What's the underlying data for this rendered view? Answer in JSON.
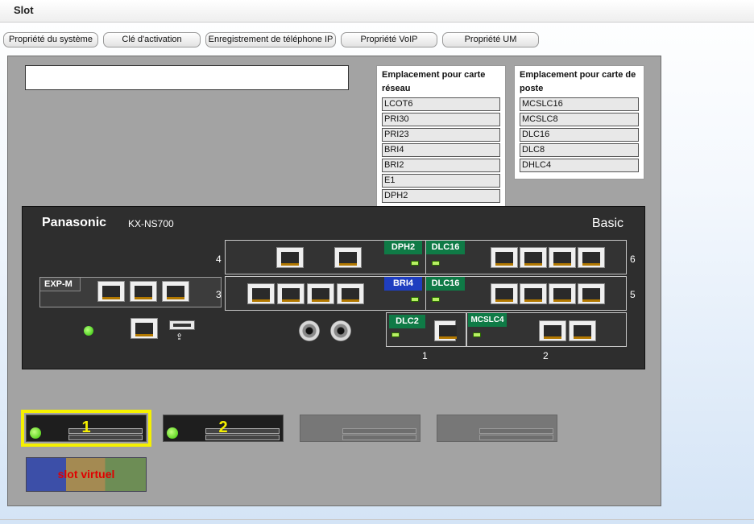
{
  "window": {
    "title": "Slot"
  },
  "tabs": [
    "Propriété du système",
    "Clé d'activation",
    "Enregistrement de téléphone IP",
    "Propriété VoIP",
    "Propriété UM"
  ],
  "network_slots": {
    "header": "Emplacement pour carte réseau",
    "items": [
      "LCOT6",
      "PRI30",
      "PRI23",
      "BRI4",
      "BRI2",
      "E1",
      "DPH2"
    ]
  },
  "extension_slots": {
    "header": "Emplacement pour carte de poste",
    "items": [
      "MCSLC16",
      "MCSLC8",
      "DLC16",
      "DLC8",
      "DHLC4"
    ]
  },
  "device": {
    "brand": "Panasonic",
    "model": "KX-NS700",
    "edition": "Basic",
    "exp_label": "EXP-M",
    "slot_numbers": {
      "s1": "1",
      "s2": "2",
      "s3": "3",
      "s4": "4",
      "s5": "5",
      "s6": "6"
    },
    "cards": {
      "slot4_left": "DPH2",
      "slot6_right": "DLC16",
      "slot3_left": "BRI4",
      "slot5_right": "DLC16",
      "slot1": "DLC2",
      "slot2": "MCSLC4"
    },
    "usb_symbol": "⇪"
  },
  "thumbnails": {
    "unit1": "1",
    "unit2": "2",
    "virtual": "slot virtuel"
  },
  "colors": {
    "card_green": "#0f7a46",
    "card_blue": "#1f3ec0",
    "selection": "#f5f100"
  }
}
